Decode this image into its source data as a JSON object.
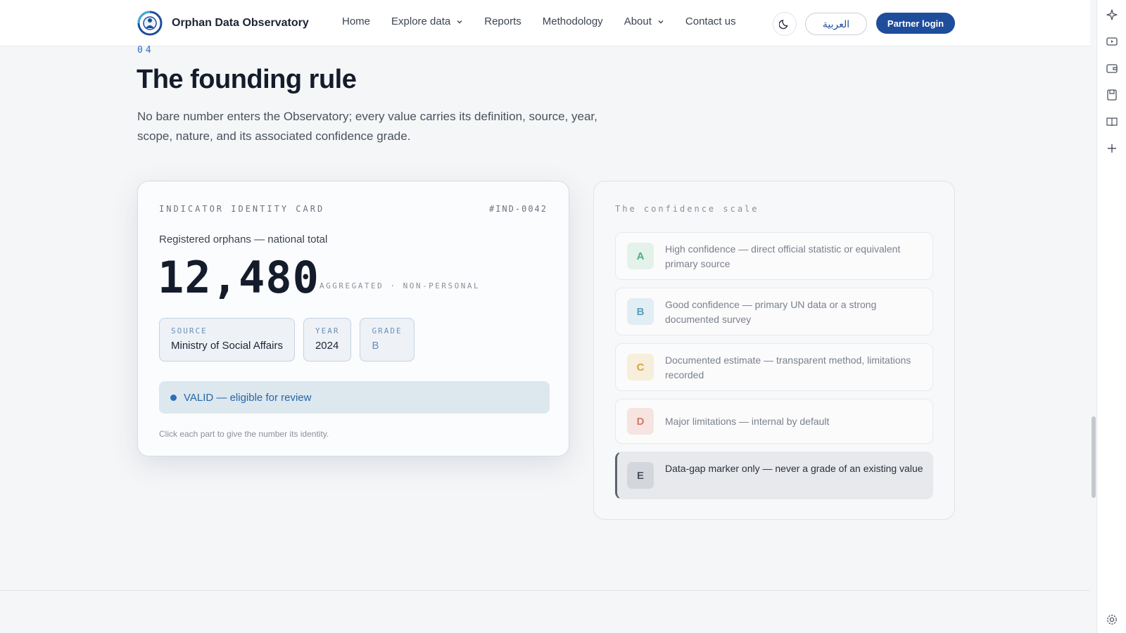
{
  "brand": {
    "name": "Orphan Data Observatory"
  },
  "nav": {
    "items": [
      {
        "label": "Home",
        "dropdown": false
      },
      {
        "label": "Explore data",
        "dropdown": true
      },
      {
        "label": "Reports",
        "dropdown": false
      },
      {
        "label": "Methodology",
        "dropdown": false
      },
      {
        "label": "About",
        "dropdown": true
      },
      {
        "label": "Contact us",
        "dropdown": false
      }
    ],
    "theme_icon": "moon-icon",
    "language_label": "العربية",
    "login_label": "Partner login"
  },
  "section": {
    "number": "04",
    "title": "The founding rule",
    "lead": "No bare number enters the Observatory; every value carries its definition, source, year, scope, nature, and its associated confidence grade."
  },
  "identity_card": {
    "label": "INDICATOR IDENTITY CARD",
    "code": "#IND-0042",
    "caption": "Registered orphans — national total",
    "value": "12,480",
    "note": "AGGREGATED · NON-PERSONAL",
    "chips": {
      "source": {
        "key": "SOURCE",
        "value": "Ministry of Social Affairs"
      },
      "year": {
        "key": "YEAR",
        "value": "2024"
      },
      "grade": {
        "key": "GRADE",
        "value": "B"
      }
    },
    "status": "VALID — eligible for review",
    "hint": "Click each part to give the number its identity."
  },
  "confidence_scale": {
    "title": "The confidence scale",
    "grades": [
      {
        "letter": "A",
        "text": "High confidence — direct official statistic or equivalent primary source",
        "color": "#4caf7d",
        "bg": "#e3f2ea"
      },
      {
        "letter": "B",
        "text": "Good confidence — primary UN data or a strong documented survey",
        "color": "#5b9fbf",
        "bg": "#e1eef4"
      },
      {
        "letter": "C",
        "text": "Documented estimate — transparent method, limitations recorded",
        "color": "#d9a441",
        "bg": "#f7eedb"
      },
      {
        "letter": "D",
        "text": "Major limitations — internal by default",
        "color": "#d47b6b",
        "bg": "#f6e4e0"
      },
      {
        "letter": "E",
        "text": "Data-gap marker only — never a grade of an existing value",
        "color": "#4a5260",
        "bg": "#d3d6db"
      }
    ],
    "active": "E"
  },
  "sidebar_icons": [
    "sparkle-icon",
    "video-icon",
    "wallet-icon",
    "save-icon",
    "book-icon",
    "plus-icon",
    "settings-icon"
  ]
}
